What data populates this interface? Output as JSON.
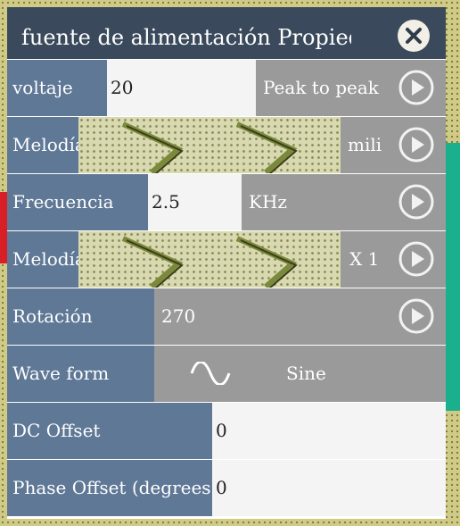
{
  "window": {
    "title": "fuente de alimentación Propiedades",
    "close_icon": "close-icon"
  },
  "rows": {
    "voltage": {
      "label": "voltaje",
      "value": "20",
      "unit": "Peak to peak"
    },
    "voltage_tune": {
      "label": "Melodía",
      "multiplier": "mili"
    },
    "frequency": {
      "label": "Frecuencia",
      "value": "2.5",
      "unit": "KHz"
    },
    "frequency_tune": {
      "label": "Melodía",
      "multiplier": "X 1"
    },
    "rotation": {
      "label": "Rotación",
      "value": "270"
    },
    "waveform": {
      "label": "Wave form",
      "icon": "sine-wave-icon",
      "value": "Sine"
    },
    "dc_offset": {
      "label": "DC Offset",
      "value": "0"
    },
    "phase_offset": {
      "label": "Phase Offset (degrees)",
      "value": "0"
    }
  },
  "colors": {
    "titlebar": "#3a4a5c",
    "label_bg": "#5f7896",
    "unit_bg": "#9a9a9a",
    "value_bg": "#f4f4f4"
  }
}
